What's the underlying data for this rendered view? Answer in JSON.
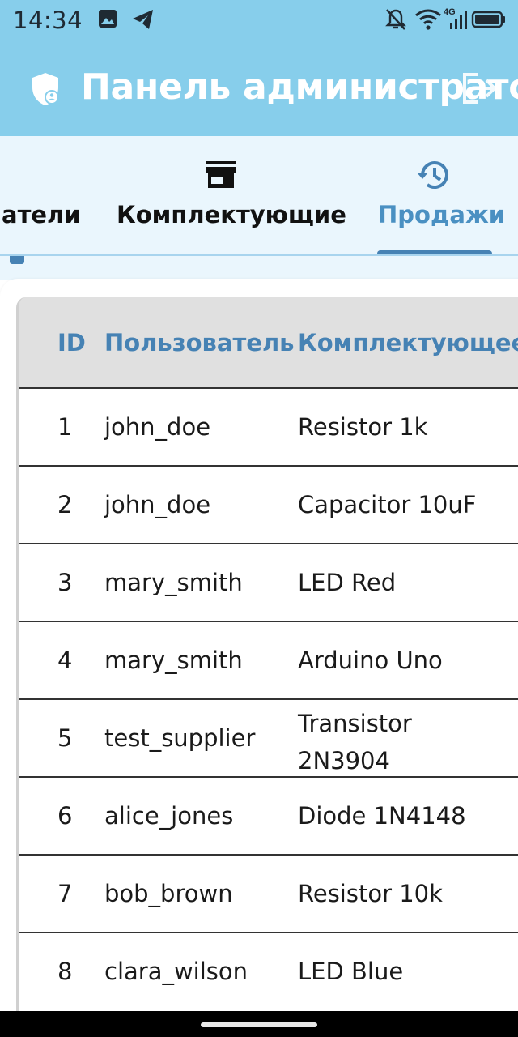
{
  "status_bar": {
    "time": "14:34",
    "network_label": "4G"
  },
  "app_bar": {
    "title": "Панель администратора"
  },
  "tabs": [
    {
      "label": "Пользователи",
      "visible_text": "атели",
      "icon": "people-icon",
      "active": false
    },
    {
      "label": "Комплектующие",
      "icon": "store-icon",
      "active": false
    },
    {
      "label": "Продажи",
      "icon": "history-icon",
      "active": true
    }
  ],
  "table": {
    "headers": [
      "ID",
      "Пользователь",
      "Комплектующее"
    ],
    "rows": [
      {
        "id": "1",
        "user": "john_doe",
        "item": "Resistor 1k"
      },
      {
        "id": "2",
        "user": "john_doe",
        "item": "Capacitor 10uF"
      },
      {
        "id": "3",
        "user": "mary_smith",
        "item": "LED Red"
      },
      {
        "id": "4",
        "user": "mary_smith",
        "item": "Arduino Uno"
      },
      {
        "id": "5",
        "user": "test_supplier",
        "item": "Transistor 2N3904"
      },
      {
        "id": "6",
        "user": "alice_jones",
        "item": "Diode 1N4148"
      },
      {
        "id": "7",
        "user": "bob_brown",
        "item": "Resistor 10k"
      },
      {
        "id": "8",
        "user": "clara_wilson",
        "item": "LED Blue"
      }
    ]
  },
  "colors": {
    "app_bar": "#87CEEB",
    "tab_bar": "#eaf6fd",
    "accent": "#4682b4",
    "header_row": "#e0e0e0"
  }
}
